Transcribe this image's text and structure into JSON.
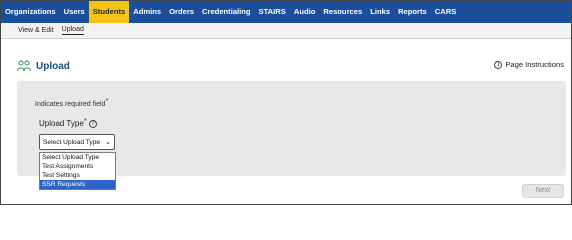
{
  "topnav": {
    "items": [
      {
        "label": "Organizations"
      },
      {
        "label": "Users"
      },
      {
        "label": "Students"
      },
      {
        "label": "Admins"
      },
      {
        "label": "Orders"
      },
      {
        "label": "Credentialing"
      },
      {
        "label": "STAIRS"
      },
      {
        "label": "Audio"
      },
      {
        "label": "Resources"
      },
      {
        "label": "Links"
      },
      {
        "label": "Reports"
      },
      {
        "label": "CARS"
      }
    ],
    "active": "Students",
    "active_color": "#f3c318",
    "bar_color": "#1b4f9c"
  },
  "subnav": {
    "items": [
      {
        "label": "View & Edit"
      },
      {
        "label": "Upload"
      }
    ],
    "active": "Upload"
  },
  "page": {
    "title": "Upload",
    "instructions_label": "Page Instructions"
  },
  "form": {
    "required_note": "Indicates required field",
    "required_mark": "*",
    "upload_type_label": "Upload Type",
    "select_value": "Select Upload Type",
    "options": [
      {
        "label": "Select Upload Type"
      },
      {
        "label": "Test Assignments"
      },
      {
        "label": "Test Settings"
      },
      {
        "label": "SSR Requests"
      }
    ],
    "highlighted_option": "SSR Requests"
  },
  "footer": {
    "next_label": "Next"
  }
}
